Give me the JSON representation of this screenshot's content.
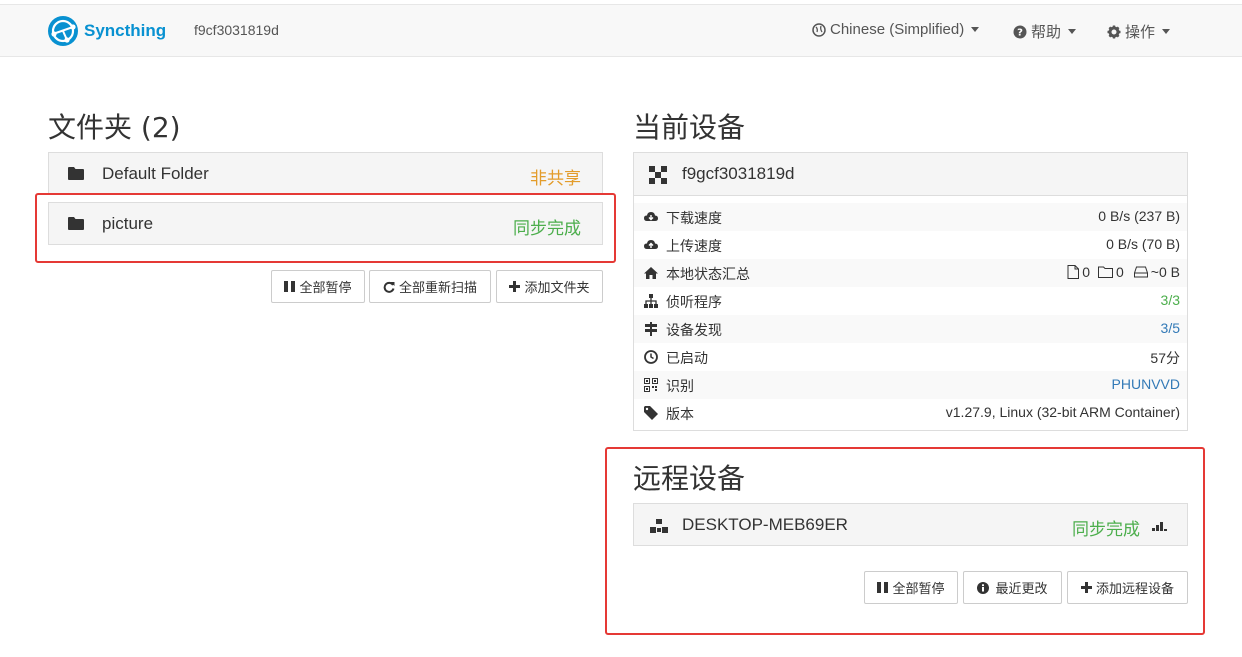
{
  "nav": {
    "brand": "Syncthing",
    "device_id": "f9cf3031819d",
    "language": "Chinese (Simplified)",
    "help": "帮助",
    "actions": "操作"
  },
  "folders": {
    "heading": "文件夹 (2)",
    "items": [
      {
        "name": "Default Folder",
        "status": "非共享"
      },
      {
        "name": "picture",
        "status": "同步完成"
      }
    ],
    "buttons": {
      "pause_all": "全部暂停",
      "rescan_all": "全部重新扫描",
      "add_folder": "添加文件夹"
    }
  },
  "this_device": {
    "heading": "当前设备",
    "name": "f9gcf3031819d",
    "stats": [
      {
        "label": "下载速度",
        "value": "0 B/s (237 B)"
      },
      {
        "label": "上传速度",
        "value": "0 B/s (70 B)"
      },
      {
        "label": "本地状态汇总",
        "files": "0",
        "dirs": "0",
        "size": "~0 B"
      },
      {
        "label": "侦听程序",
        "value": "3/3"
      },
      {
        "label": "设备发现",
        "value": "3/5"
      },
      {
        "label": "已启动",
        "value": "57分"
      },
      {
        "label": "识别",
        "value": "PHUNVVD"
      },
      {
        "label": "版本",
        "value": "v1.27.9, Linux (32-bit ARM Container)"
      }
    ]
  },
  "remote_devices": {
    "heading": "远程设备",
    "items": [
      {
        "name": "DESKTOP-MEB69ER",
        "status": "同步完成"
      }
    ],
    "buttons": {
      "pause_all": "全部暂停",
      "recent_changes": "最近更改",
      "add_remote": "添加远程设备"
    }
  },
  "colors": {
    "brand": "#0891d1",
    "status_orange": "#e39c2a",
    "status_green": "#4cae4c",
    "link_blue": "#337ab7",
    "highlight_red": "#e53935"
  }
}
